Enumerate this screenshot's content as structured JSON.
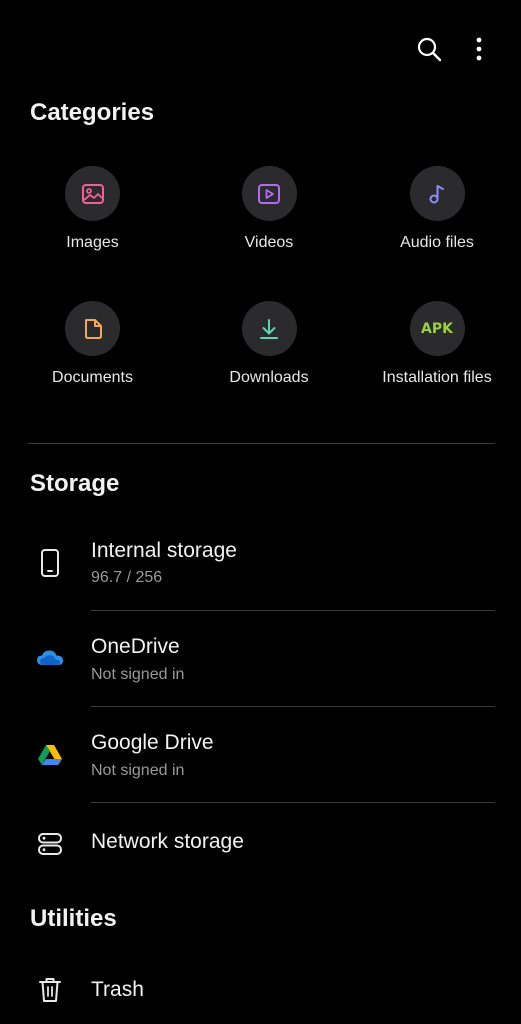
{
  "colors": {
    "background": "#000000",
    "icon_circle": "#2b2b2e",
    "images_accent": "#f06292",
    "videos_accent": "#b36cf0",
    "audio_accent": "#8c8cff",
    "documents_accent": "#f0a85a",
    "downloads_accent": "#5fd3b8",
    "apk_accent": "#9bd33b",
    "subtitle_gray": "#9a9a9a"
  },
  "toolbar": {
    "search_icon": "search-icon",
    "more_icon": "more-vertical-icon"
  },
  "categories": {
    "title": "Categories",
    "items": [
      {
        "label": "Images",
        "icon": "image-icon"
      },
      {
        "label": "Videos",
        "icon": "video-icon"
      },
      {
        "label": "Audio files",
        "icon": "music-note-icon"
      },
      {
        "label": "Documents",
        "icon": "document-icon"
      },
      {
        "label": "Downloads",
        "icon": "download-icon"
      },
      {
        "label": "Installation files",
        "icon": "apk-icon",
        "badge": "APK"
      }
    ]
  },
  "storage": {
    "title": "Storage",
    "items": [
      {
        "title": "Internal storage",
        "subtitle": "96.7 / 256",
        "icon": "phone-icon"
      },
      {
        "title": "OneDrive",
        "subtitle": "Not signed in",
        "icon": "onedrive-cloud-icon"
      },
      {
        "title": "Google Drive",
        "subtitle": "Not signed in",
        "icon": "google-drive-icon"
      },
      {
        "title": "Network storage",
        "icon": "server-icon"
      }
    ]
  },
  "utilities": {
    "title": "Utilities",
    "items": [
      {
        "title": "Trash",
        "icon": "trash-icon"
      }
    ]
  }
}
